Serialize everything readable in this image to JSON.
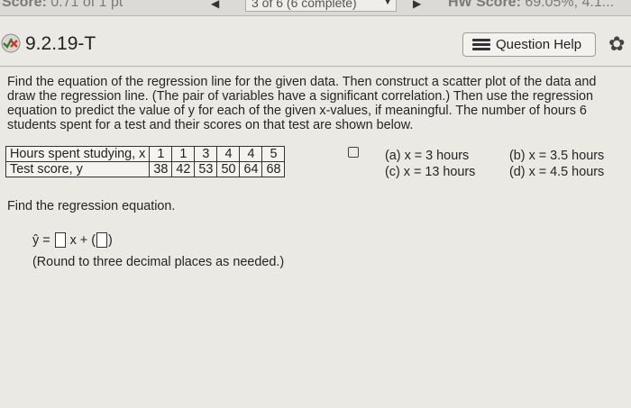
{
  "topbar": {
    "score_label": "Score:",
    "score_value": "0.71 of 1 pt",
    "progress": "3 of 6 (6 complete)",
    "hw_label": "HW Score:",
    "hw_value": "69.05%, 4.1..."
  },
  "question": {
    "id": "9.2.19-T",
    "help_label": "Question Help"
  },
  "problem_text": "Find the equation of the regression line for the given data. Then construct a scatter plot of the data and draw the regression line. (The pair of variables have a significant correlation.) Then use the regression equation to predict the value of y for each of the given x-values, if meaningful. The number of hours 6 students spent for a test and their scores on that test are shown below.",
  "table": {
    "row1_label": "Hours spent studying, x",
    "row2_label": "Test score, y",
    "x": [
      "1",
      "1",
      "3",
      "4",
      "4",
      "5"
    ],
    "y": [
      "38",
      "42",
      "53",
      "50",
      "64",
      "68"
    ]
  },
  "options": {
    "a": "(a) x = 3 hours",
    "b": "(b) x = 3.5 hours",
    "c": "(c) x = 13 hours",
    "d": "(d) x = 4.5 hours"
  },
  "find_text": "Find the regression equation.",
  "equation": {
    "yhat": "ŷ =",
    "x_plus": "x +",
    "open_paren": "(",
    "close_paren": ")"
  },
  "round_note": "(Round to three decimal places as needed.)"
}
